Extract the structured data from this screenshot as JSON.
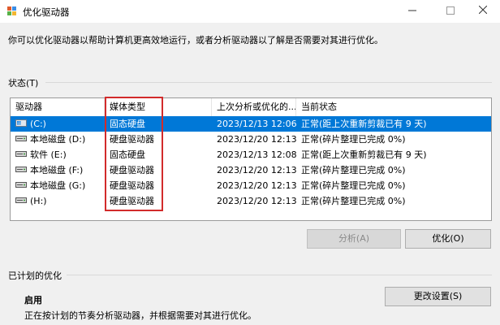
{
  "window": {
    "title": "优化驱动器"
  },
  "description": "你可以优化驱动器以帮助计算机更高效地运行，或者分析驱动器以了解是否需要对其进行优化。",
  "status_section": {
    "label": "状态(T)",
    "columns": [
      "驱动器",
      "媒体类型",
      "上次分析或优化的...",
      "当前状态"
    ],
    "rows": [
      {
        "drive": "(C:)",
        "media": "固态硬盘",
        "last": "2023/12/13 12:06",
        "status": "正常(距上次重新剪裁已有 9 天)",
        "icon": "windows-drive-icon",
        "selected": true
      },
      {
        "drive": "本地磁盘 (D:)",
        "media": "硬盘驱动器",
        "last": "2023/12/20 12:13",
        "status": "正常(碎片整理已完成 0%)",
        "icon": "hard-drive-icon",
        "selected": false
      },
      {
        "drive": "软件 (E:)",
        "media": "固态硬盘",
        "last": "2023/12/13 12:08",
        "status": "正常(距上次重新剪裁已有 9 天)",
        "icon": "hard-drive-icon",
        "selected": false
      },
      {
        "drive": "本地磁盘 (F:)",
        "media": "硬盘驱动器",
        "last": "2023/12/20 12:13",
        "status": "正常(碎片整理已完成 0%)",
        "icon": "hard-drive-icon",
        "selected": false
      },
      {
        "drive": "本地磁盘 (G:)",
        "media": "硬盘驱动器",
        "last": "2023/12/20 12:13",
        "status": "正常(碎片整理已完成 0%)",
        "icon": "hard-drive-icon",
        "selected": false
      },
      {
        "drive": "(H:)",
        "media": "硬盘驱动器",
        "last": "2023/12/20 12:13",
        "status": "正常(碎片整理已完成 0%)",
        "icon": "hard-drive-icon",
        "selected": false
      }
    ],
    "analyze_label": "分析(A)",
    "optimize_label": "优化(O)"
  },
  "scheduled_section": {
    "label": "已计划的优化",
    "status": "启用",
    "change_settings_label": "更改设置(S)",
    "description": "正在按计划的节奏分析驱动器，并根据需要对其进行优化。"
  },
  "colors": {
    "selection": "#0078d7",
    "highlight_box": "#d22b2b"
  }
}
